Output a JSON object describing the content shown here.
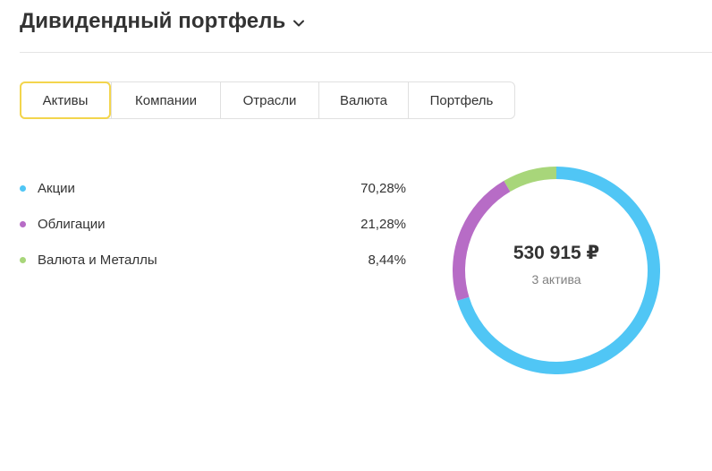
{
  "header": {
    "title": "Дивидендный портфель",
    "chevron_icon": "chevron-down-icon"
  },
  "tabs": [
    {
      "label": "Активы",
      "active": true
    },
    {
      "label": "Компании",
      "active": false
    },
    {
      "label": "Отрасли",
      "active": false
    },
    {
      "label": "Валюта",
      "active": false
    },
    {
      "label": "Портфель",
      "active": false
    }
  ],
  "colors": {
    "accent_active_tab": "#f3d54d",
    "stocks": "#50c6f5",
    "bonds": "#b76cc6",
    "currency_metals": "#a8d67a"
  },
  "legend": [
    {
      "label": "Акции",
      "value": "70,28%",
      "color": "#50c6f5"
    },
    {
      "label": "Облигации",
      "value": "21,28%",
      "color": "#b76cc6"
    },
    {
      "label": "Валюта и Металлы",
      "value": "8,44%",
      "color": "#a8d67a"
    }
  ],
  "chart_data": {
    "type": "pie",
    "categories": [
      "Акции",
      "Облигации",
      "Валюта и Металлы"
    ],
    "values": [
      70.28,
      21.28,
      8.44
    ],
    "colors": [
      "#50c6f5",
      "#b76cc6",
      "#a8d67a"
    ],
    "center_total": "530 915 ₽",
    "center_subtitle": "3 актива"
  }
}
